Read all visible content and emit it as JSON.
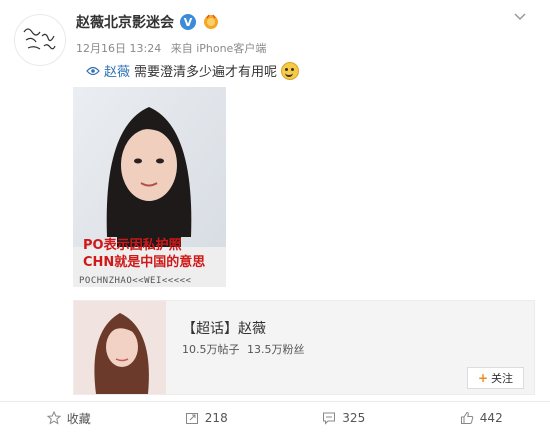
{
  "post": {
    "author": "赵薇北京影迷会",
    "verified_badge": "V",
    "date": "12月16日 13:24",
    "source": "来自 iPhone客户端",
    "mention": "赵薇",
    "text": "需要澄清多少遍才有用呢",
    "photo_caption_line1": "PO表示因私护照",
    "photo_caption_line2": "CHN就是中国的意思",
    "photo_mrz": "POCHNZHAO<<WEI<<<<<"
  },
  "supertopic": {
    "title": "【超话】赵薇",
    "posts": "10.5万帖子",
    "fans": "13.5万粉丝",
    "follow_label": "关注"
  },
  "actions": {
    "collect": "收藏",
    "repost": "218",
    "comment": "325",
    "like": "442"
  },
  "icons": {
    "dropdown": "chevron-down-icon",
    "mention": "mention-link-icon",
    "emoji": "sweat-smile-emoji",
    "collect": "star-icon",
    "repost": "repost-icon",
    "comment": "comment-icon",
    "like": "thumbs-up-icon"
  },
  "colors": {
    "link": "#3072b5",
    "verified": "#3b8bd9",
    "caption_red": "#d01818",
    "follow_plus": "#f08a24"
  }
}
